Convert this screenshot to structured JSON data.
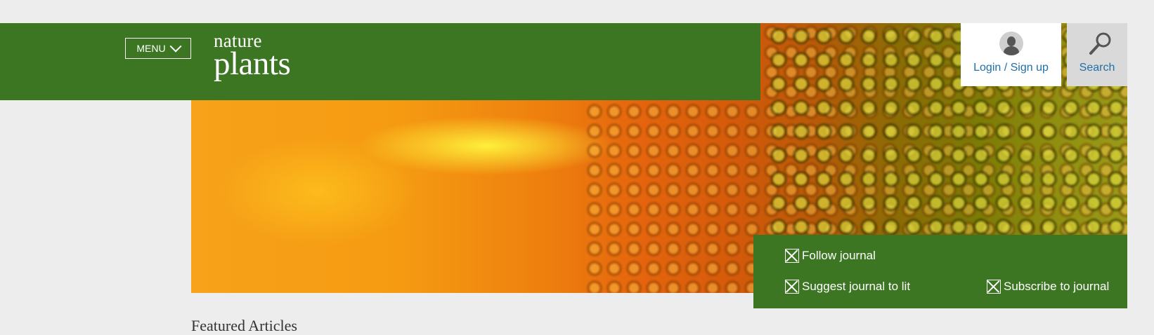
{
  "header": {
    "menu_label": "MENU",
    "logo_line1": "nature",
    "logo_line2": "plants",
    "bar_color": "#3c7622"
  },
  "account": {
    "login_label": "Login / Sign up",
    "search_label": "Search"
  },
  "actions": [
    {
      "label": "Follow journal"
    },
    {
      "label": "Suggest journal to lit"
    },
    {
      "label": "Subscribe to journal"
    }
  ],
  "section": {
    "heading": "Featured Articles"
  },
  "colors": {
    "link": "#1f6fa8",
    "page_bg": "#ededed"
  }
}
